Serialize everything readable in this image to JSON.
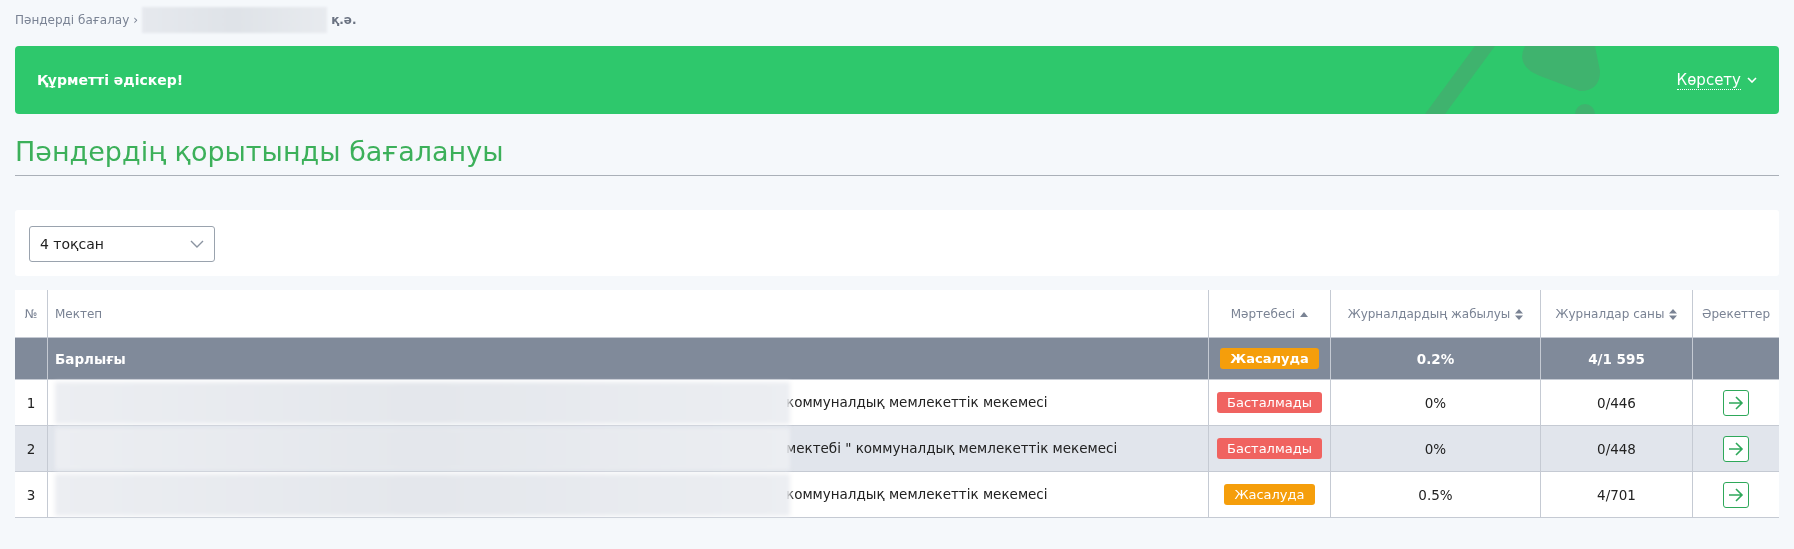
{
  "breadcrumb": {
    "root": "Пәндерді бағалау",
    "separator": "›",
    "current_tail": "қ.ә."
  },
  "banner": {
    "greeting": "Құрметті әдіскер!",
    "toggle": "Көрсету",
    "expanded": false
  },
  "page_title": "Пәндердің қорытынды бағалануы",
  "filter": {
    "quarter": "4 тоқсан"
  },
  "table": {
    "columns": [
      {
        "label": "№",
        "kind": "plain"
      },
      {
        "label": "Мектеп",
        "kind": "plain"
      },
      {
        "label": "Мәртебесі",
        "kind": "ascending"
      },
      {
        "label": "Журналдардың жабылуы",
        "kind": "sortable"
      },
      {
        "label": "Журналдар саны",
        "kind": "sortable"
      },
      {
        "label": "Әрекеттер",
        "kind": "plain"
      }
    ],
    "total": {
      "label": "Барлығы",
      "status": "Жасалуда",
      "color": "#f59e0b",
      "closing": "0.2%",
      "count": "4/1 595"
    },
    "rows": [
      {
        "number": "1",
        "school_visible": "коммуналдық мемлекеттік мекемесі",
        "status": "Басталмады",
        "color": "#f06360",
        "closing": "0%",
        "count": "0/446",
        "selected": false
      },
      {
        "number": "2",
        "school_visible": "мектебі \" коммуналдық мемлекеттік мекемесі",
        "status": "Басталмады",
        "color": "#f06360",
        "closing": "0%",
        "count": "0/448",
        "selected": true
      },
      {
        "number": "3",
        "school_visible": "коммуналдық мемлекеттік мекемесі",
        "status": "Жасалуда",
        "color": "#f59e0b",
        "closing": "0.5%",
        "count": "4/701",
        "selected": false
      }
    ]
  }
}
